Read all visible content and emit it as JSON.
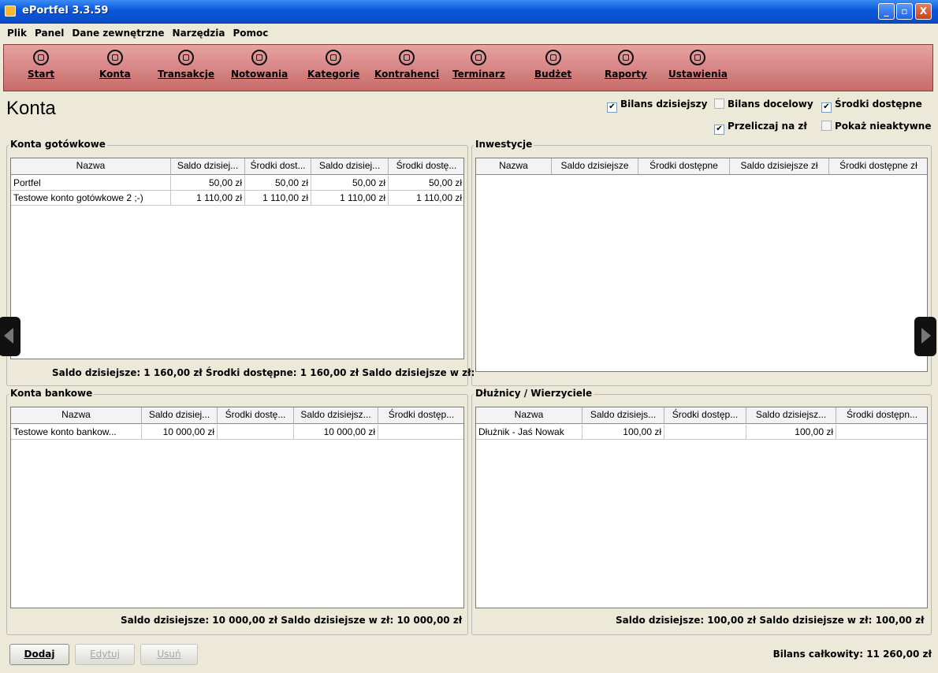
{
  "window": {
    "title": "ePortfel 3.3.59",
    "minimize": "_",
    "maximize": "▫",
    "close": "X"
  },
  "menu": [
    "Plik",
    "Panel",
    "Dane zewnętrzne",
    "Narzędzia",
    "Pomoc"
  ],
  "toolbar": [
    {
      "label": "Start",
      "icon": "start-icon"
    },
    {
      "label": "Konta",
      "icon": "accounts-icon"
    },
    {
      "label": "Transakcje",
      "icon": "transactions-icon"
    },
    {
      "label": "Notowania",
      "icon": "quotes-icon"
    },
    {
      "label": "Kategorie",
      "icon": "categories-icon"
    },
    {
      "label": "Kontrahenci",
      "icon": "contractors-icon"
    },
    {
      "label": "Terminarz",
      "icon": "calendar-icon"
    },
    {
      "label": "Budżet",
      "icon": "budget-icon"
    },
    {
      "label": "Raporty",
      "icon": "reports-icon"
    },
    {
      "label": "Ustawienia",
      "icon": "settings-icon"
    }
  ],
  "page_title": "Konta",
  "options": {
    "bilans_dzisiejszy": {
      "label": "Bilans dzisiejszy",
      "checked": true
    },
    "bilans_docelowy": {
      "label": "Bilans docelowy",
      "checked": false
    },
    "srodki_dostepne": {
      "label": "Środki dostępne",
      "checked": true
    },
    "przeliczaj": {
      "label": "Przeliczaj na zł",
      "checked": true
    },
    "pokaz_nieaktywne": {
      "label": "Pokaż nieaktywne",
      "checked": false
    },
    "check_mark": "✔"
  },
  "cash": {
    "title": "Konta gotówkowe",
    "columns": [
      "Nazwa",
      "Saldo dzisiej...",
      "Środki dost...",
      "Saldo dzisiej...",
      "Środki dostę..."
    ],
    "rows": [
      [
        "Portfel",
        "50,00 zł",
        "50,00 zł",
        "50,00 zł",
        "50,00 zł"
      ],
      [
        "Testowe konto gotówkowe 2 ;-)",
        "1 110,00 zł",
        "1 110,00 zł",
        "1 110,00 zł",
        "1 110,00 zł"
      ]
    ],
    "summary": "Saldo dzisiejsze:  1 160,00 zł  Środki dostępne:  1 160,00 zł  Saldo dzisiejsze w zł:"
  },
  "investments": {
    "title": "Inwestycje",
    "columns": [
      "Nazwa",
      "Saldo dzisiejsze",
      "Środki dostępne",
      "Saldo dzisiejsze zł",
      "Środki dostępne zł"
    ],
    "rows": []
  },
  "bank": {
    "title": "Konta bankowe",
    "columns": [
      "Nazwa",
      "Saldo dzisiej...",
      "Środki dostę...",
      "Saldo dzisiejsz...",
      "Środki dostęp..."
    ],
    "rows": [
      [
        "Testowe konto bankow...",
        "10 000,00 zł",
        "",
        "10 000,00 zł",
        ""
      ]
    ],
    "summary": "Saldo dzisiejsze:  10 000,00 zł   Saldo dzisiejsze w zł:  10 000,00 zł"
  },
  "debtors": {
    "title": "Dłużnicy / Wierzyciele",
    "columns": [
      "Nazwa",
      "Saldo dzisiejs...",
      "Środki dostęp...",
      "Saldo dzisiejsz...",
      "Środki dostępn..."
    ],
    "rows": [
      [
        "Dłużnik - Jaś Nowak",
        "100,00 zł",
        "",
        "100,00 zł",
        ""
      ]
    ],
    "summary": "Saldo dzisiejsze:  100,00 zł   Saldo dzisiejsze w zł:  100,00 zł"
  },
  "buttons": {
    "add": "Dodaj",
    "edit": "Edytuj",
    "delete": "Usuń"
  },
  "total": "Bilans całkowity:  11 260,00 zł",
  "colors": {
    "toolbar": "#d98a8a",
    "titlebar": "#0a56d8",
    "background": "#ece9d8"
  }
}
